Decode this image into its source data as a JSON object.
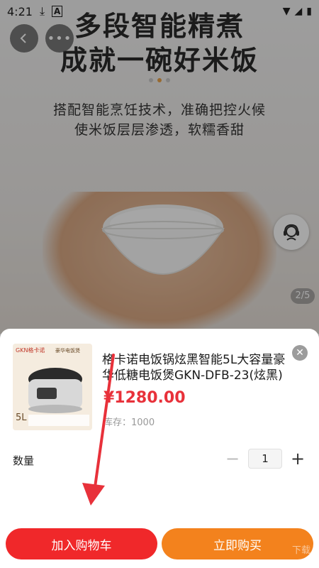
{
  "status_bar": {
    "time": "4:21",
    "left_icons": [
      "download-icon",
      "text-a-icon"
    ],
    "right_icons": [
      "wifi-icon",
      "signal-icon",
      "battery-icon"
    ]
  },
  "hero": {
    "title_line1": "多段智能精煮",
    "title_line2": "成就一碗好米饭",
    "subtitle_line1": "搭配智能烹饪技术，准确把控火候",
    "subtitle_line2": "使米饭层层渗透，软糯香甜",
    "page_indicator": "2/5"
  },
  "nav": {
    "back_icon": "chevron-left-icon",
    "more_icon": "more-dots-icon"
  },
  "service": {
    "icon": "customer-service-icon"
  },
  "sheet": {
    "product_title": "格卡诺电饭锅炫黑智能5L大容量豪华低糖电饭煲GKN-DFB-23(炫黑)",
    "price": "¥1280.00",
    "stock": "库存：1000",
    "quantity_label": "数量",
    "quantity": "1",
    "minus_symbol": "−",
    "plus_symbol": "+",
    "close_symbol": "✕",
    "thumbnail": {
      "brand": "GKN格卡诺",
      "tag": "豪华电饭煲",
      "capacity": "5L"
    }
  },
  "actions": {
    "add_to_cart": "加入购物车",
    "buy_now": "立即购买"
  },
  "watermark": "下载",
  "colors": {
    "price": "#e8313a",
    "cart_button": "#f0282a",
    "buy_button": "#f3821d",
    "annotation_arrow": "#e8313a"
  }
}
